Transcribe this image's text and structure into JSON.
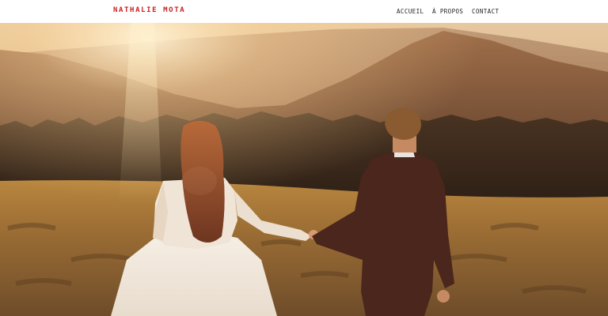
{
  "header": {
    "brand": "NATHALIE MOTA",
    "nav": [
      "ACCUEIL",
      "À PROPOS",
      "CONTACT"
    ]
  },
  "colors": {
    "brand": "#cc1f1f",
    "nav_text": "#222222",
    "header_bg": "#ffffff"
  },
  "hero": {
    "image": "wedding-couple-sunset-photo"
  }
}
